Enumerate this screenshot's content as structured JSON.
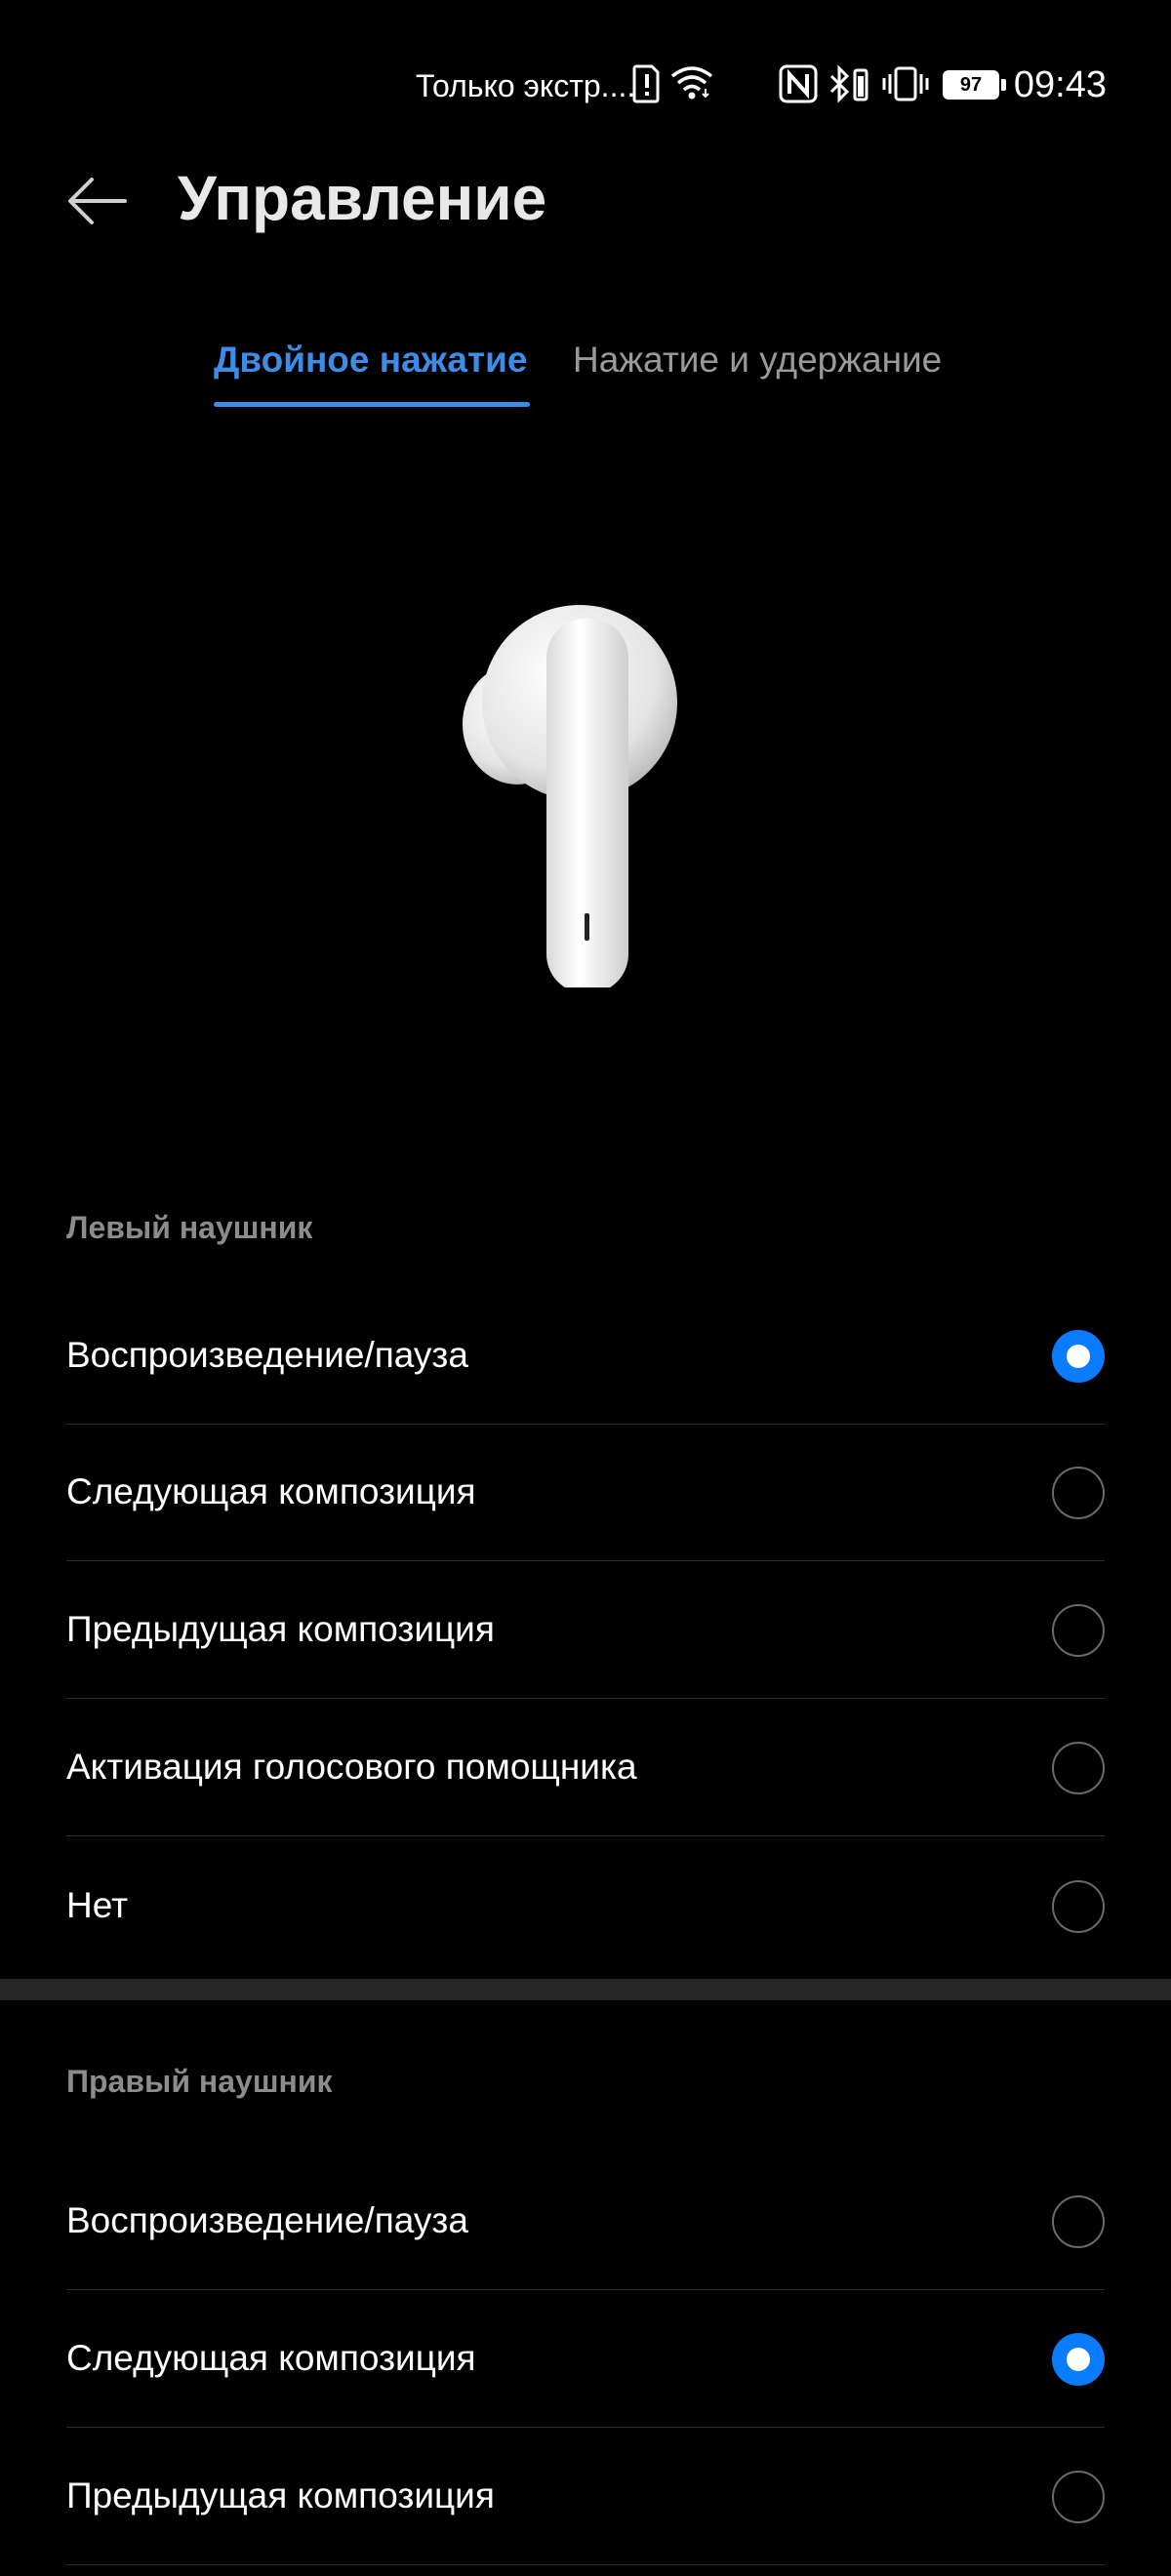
{
  "status_bar": {
    "carrier_text": "Только экстр....",
    "time": "09:43",
    "battery_level": "97",
    "icons": [
      "alert-sim-icon",
      "wifi-icon",
      "nfc-icon",
      "bluetooth-icon",
      "vibrate-icon",
      "battery-icon"
    ]
  },
  "header": {
    "title": "Управление",
    "back_icon": "arrow-left-icon"
  },
  "tabs": [
    {
      "label": "Двойное нажатие",
      "active": true
    },
    {
      "label": "Нажатие и удержание",
      "active": false
    }
  ],
  "image": {
    "name": "earbud-image"
  },
  "left_section": {
    "title": "Левый наушник",
    "options": [
      {
        "label": "Воспроизведение/пауза",
        "selected": true
      },
      {
        "label": "Следующая композиция",
        "selected": false
      },
      {
        "label": "Предыдущая композиция",
        "selected": false
      },
      {
        "label": "Активация голосового помощника",
        "selected": false
      },
      {
        "label": "Нет",
        "selected": false
      }
    ]
  },
  "right_section": {
    "title": "Правый наушник",
    "options": [
      {
        "label": "Воспроизведение/пауза",
        "selected": false
      },
      {
        "label": "Следующая композиция",
        "selected": true
      },
      {
        "label": "Предыдущая композиция",
        "selected": false
      }
    ]
  },
  "colors": {
    "accent": "#3d8ce8",
    "radio_selected": "#0a7cff",
    "background": "#000000"
  }
}
